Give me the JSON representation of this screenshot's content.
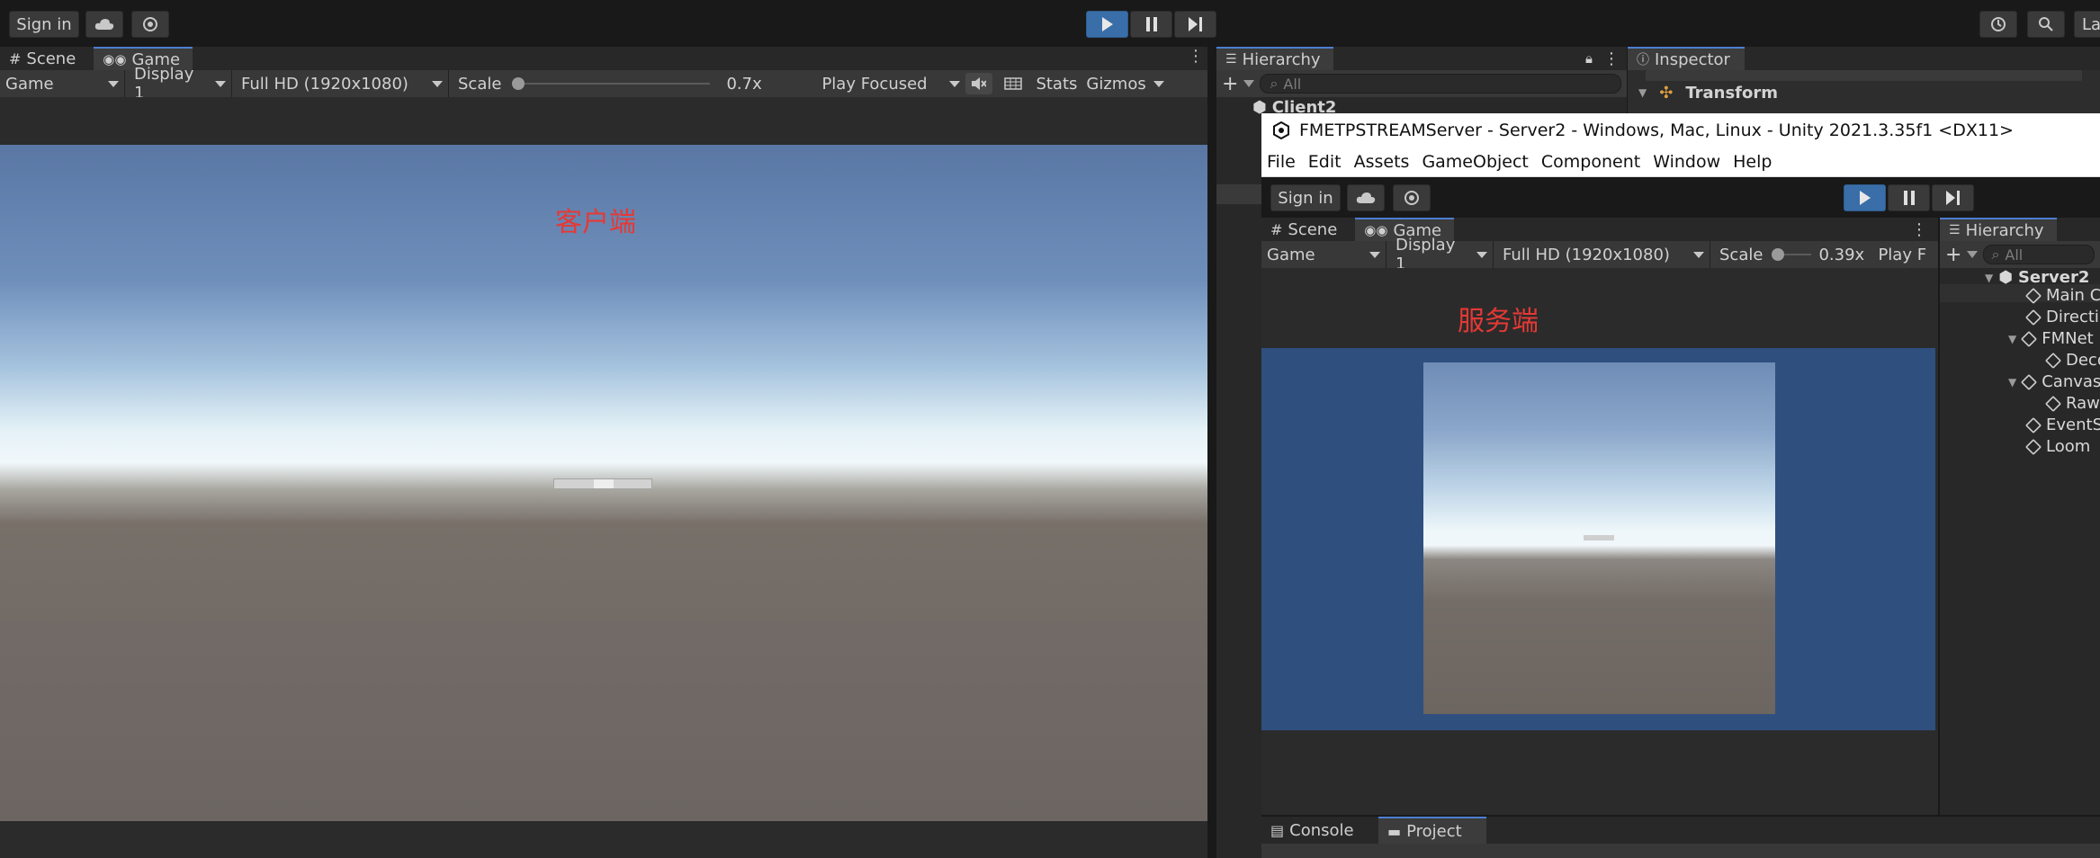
{
  "top_toolbar": {
    "sign_in": "Sign in",
    "icons": [
      "cloud-icon",
      "settings-icon",
      "play-icon",
      "pause-icon",
      "step-icon",
      "history-icon",
      "search-icon"
    ],
    "layout_label": "Lay"
  },
  "client": {
    "tabs": [
      "Scene",
      "Game"
    ],
    "toolbar": {
      "game": "Game",
      "display": "Display 1",
      "resolution": "Full HD (1920x1080)",
      "scale_label": "Scale",
      "scale_value": "0.7x",
      "play_mode": "Play Focused",
      "stats": "Stats",
      "gizmos": "Gizmos"
    },
    "overlay_text": "客户端"
  },
  "hierarchy_back": {
    "title": "Hierarchy",
    "search_placeholder": "All",
    "first_item": "Client2"
  },
  "inspector_back": {
    "title": "Inspector",
    "transform": "Transform"
  },
  "server_window": {
    "title": "FMETPSTREAMServer - Server2 - Windows, Mac, Linux - Unity 2021.3.35f1 <DX11>",
    "menu": [
      "File",
      "Edit",
      "Assets",
      "GameObject",
      "Component",
      "Window",
      "Help"
    ],
    "sign_in": "Sign in",
    "tabs": [
      "Scene",
      "Game"
    ],
    "toolbar": {
      "game": "Game",
      "display": "Display 1",
      "resolution": "Full HD (1920x1080)",
      "scale_label": "Scale",
      "scale_value": "0.39x",
      "play_mode": "Play F"
    },
    "overlay_text": "服务端",
    "hierarchy": {
      "title": "Hierarchy",
      "search_placeholder": "All",
      "items": [
        "Server2",
        "Main C",
        "Directi",
        "FMNet",
        "Deco",
        "Canvas",
        "Rawl",
        "EventS",
        "Loom"
      ]
    },
    "bottom_tabs": [
      "Console",
      "Project"
    ]
  },
  "colors": {
    "accent_blue": "#4c7fd0",
    "overlay_red": "#e53935",
    "server_view_bg": "#2f4f7f"
  }
}
